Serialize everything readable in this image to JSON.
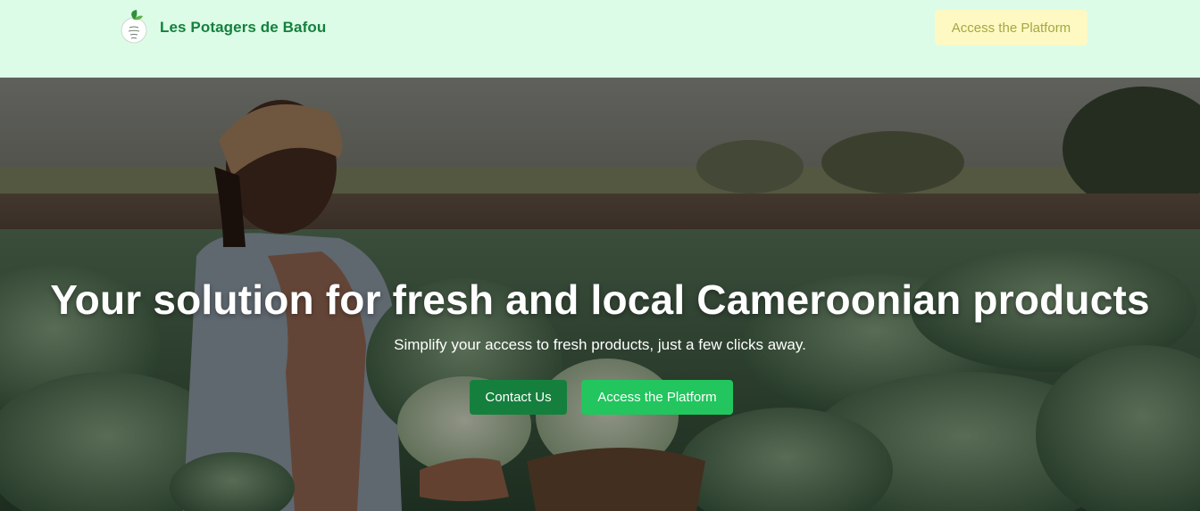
{
  "header": {
    "brand_name": "Les Potagers de Bafou",
    "logo_text": "Potagers de Bafou",
    "cta_label": "Access the Platform"
  },
  "hero": {
    "title": "Your solution for fresh and local Cameroonian products",
    "subtitle": "Simplify your access to fresh products, just a few clicks away.",
    "contact_label": "Contact Us",
    "access_label": "Access the Platform"
  },
  "colors": {
    "nav_bg": "#dcfce7",
    "brand_green": "#15803d",
    "nav_cta_bg": "#fef9c3",
    "accent_green": "#22c55e"
  }
}
